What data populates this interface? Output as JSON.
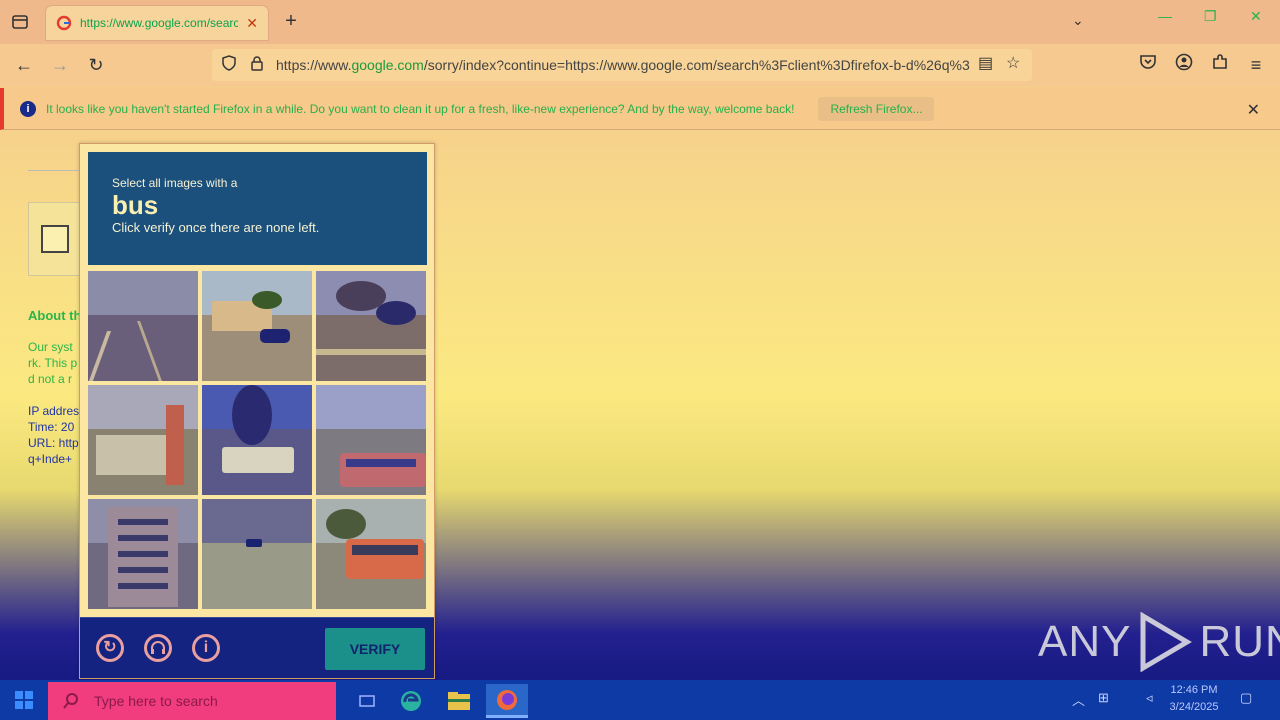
{
  "browser": {
    "tab": {
      "title": "https://www.google.com/searc"
    },
    "url": {
      "prefix": "https://www.",
      "domain": "google.com",
      "rest": "/sorry/index?continue=https://www.google.com/search%3Fclient%3Dfirefox-b-d%26q%3"
    },
    "notification": {
      "message": "It looks like you haven't started Firefox in a while. Do you want to clean it up for a fresh, like-new experience? And by the way, welcome back!",
      "button": "Refresh Firefox..."
    }
  },
  "page": {
    "about_heading": "About th",
    "lines": [
      "Our syst",
      "rk. This p",
      "d not a r"
    ],
    "info_lines": [
      "IP addres",
      "Time: 20",
      "URL: http",
      "q+Inde+"
    ]
  },
  "captcha": {
    "instruction_prefix": "Select all images with a",
    "target": "bus",
    "instruction_suffix": "Click verify once there are none left.",
    "verify_label": "VERIFY",
    "tiles": [
      {
        "desc": "road"
      },
      {
        "desc": "house-with-car"
      },
      {
        "desc": "palm-trees"
      },
      {
        "desc": "brick-chimney-house"
      },
      {
        "desc": "bus-under-tree"
      },
      {
        "desc": "school-bus"
      },
      {
        "desc": "apartment-building"
      },
      {
        "desc": "street-car"
      },
      {
        "desc": "yellow-school-bus"
      }
    ]
  },
  "watermark": {
    "text_left": "ANY",
    "text_right": "RUN"
  },
  "taskbar": {
    "search_placeholder": "Type here to search",
    "time": "12:46 PM",
    "date": "3/24/2025"
  },
  "colors": {
    "header_blue": "#1b4f7c",
    "verify_teal": "#1b8f8a",
    "taskbar_blue": "#0e3aa5",
    "search_pink": "#f13d7e"
  }
}
